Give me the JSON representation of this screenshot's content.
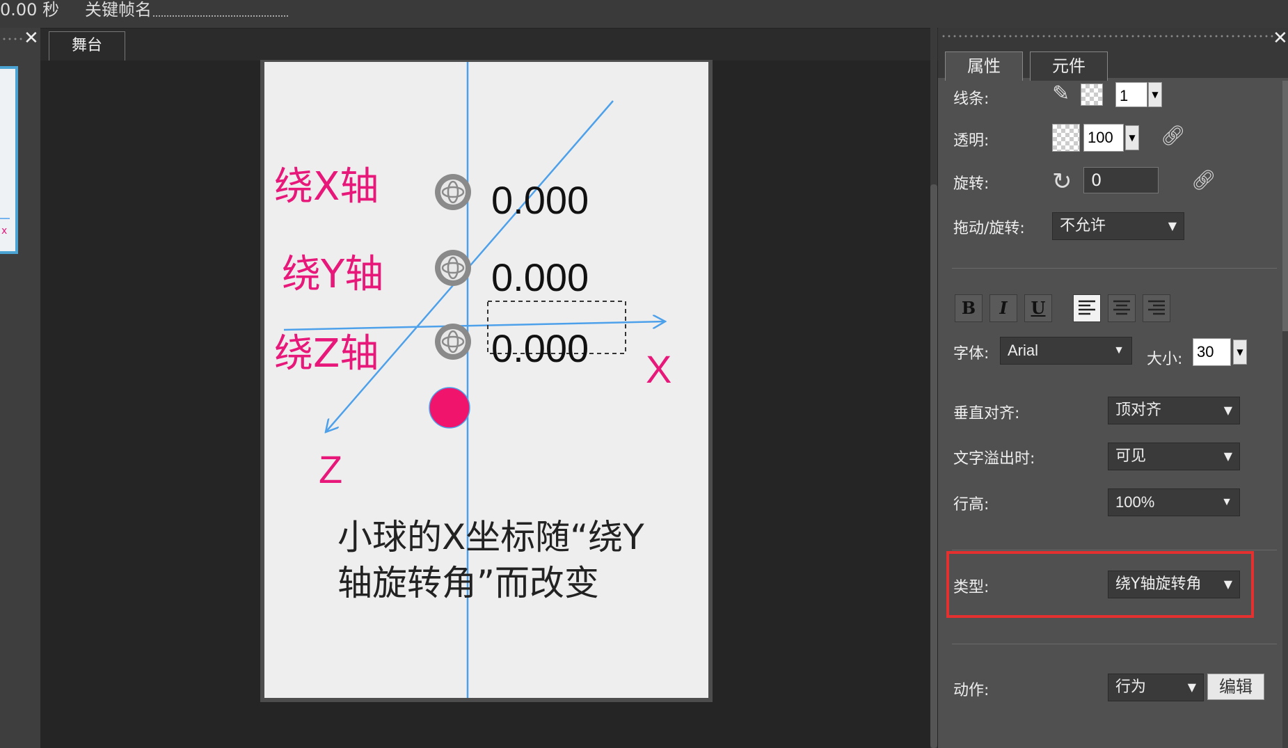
{
  "topbar": {
    "time": "0.00 秒",
    "keyframe_name": "关键帧名"
  },
  "stage": {
    "tab_label": "舞台"
  },
  "canvas": {
    "rotate_x_label": "绕X轴",
    "rotate_y_label": "绕Y轴",
    "rotate_z_label": "绕Z轴",
    "value_x": "0.000",
    "value_y": "0.000",
    "value_z": "0.000",
    "axis_x": "X",
    "axis_z": "Z",
    "description": "小球的X坐标随“绕Y轴旋转角”而改变",
    "ball_color": "#f0146c",
    "axis_color": "#4da0ea"
  },
  "panel": {
    "tabs": [
      "属性",
      "元件"
    ],
    "stroke": {
      "label": "线条:",
      "width": "1"
    },
    "opacity": {
      "label": "透明:",
      "value": "100"
    },
    "rotation": {
      "label": "旋转:",
      "value": "0"
    },
    "drag": {
      "label": "拖动/旋转:",
      "value": "不允许"
    },
    "format_buttons": [
      "B",
      "I",
      "U"
    ],
    "font": {
      "label": "字体:",
      "value": "Arial",
      "size_label": "大小:",
      "size": "30"
    },
    "valign": {
      "label": "垂直对齐:",
      "value": "顶对齐"
    },
    "overflow": {
      "label": "文字溢出时:",
      "value": "可见"
    },
    "line_height": {
      "label": "行高:",
      "value": "100%"
    },
    "type": {
      "label": "类型:",
      "value": "绕Y轴旋转角"
    },
    "action": {
      "label": "动作:",
      "value": "行为",
      "edit_button": "编辑"
    }
  },
  "icons": [
    "close-icon",
    "pencil-icon",
    "rotate-icon",
    "link-icon",
    "align-left-icon",
    "align-center-icon",
    "align-right-icon",
    "orb-icon",
    "chevron-down-icon"
  ],
  "highlight_color": "#e53030"
}
